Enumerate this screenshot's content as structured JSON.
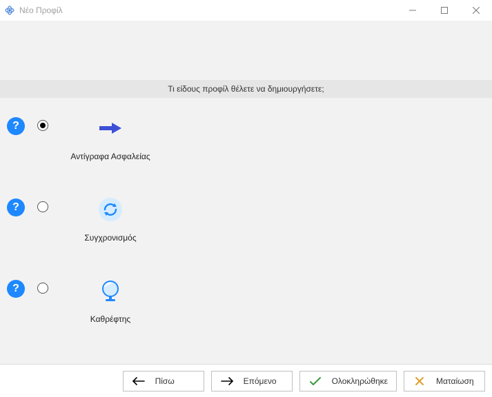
{
  "window": {
    "title": "Νέο Προφίλ"
  },
  "prompt": "Τι είδους προφίλ θέλετε να δημιουργήσετε;",
  "options": [
    {
      "id": "backup",
      "label": "Αντίγραφα Ασφαλείας",
      "selected": true,
      "icon": "arrow-right-icon"
    },
    {
      "id": "sync",
      "label": "Συγχρονισμός",
      "selected": false,
      "icon": "sync-icon"
    },
    {
      "id": "mirror",
      "label": "Καθρέφτης",
      "selected": false,
      "icon": "mirror-icon"
    }
  ],
  "buttons": {
    "back": "Πίσω",
    "next": "Επόμενο",
    "finish": "Ολοκληρώθηκε",
    "cancel": "Ματαίωση"
  }
}
